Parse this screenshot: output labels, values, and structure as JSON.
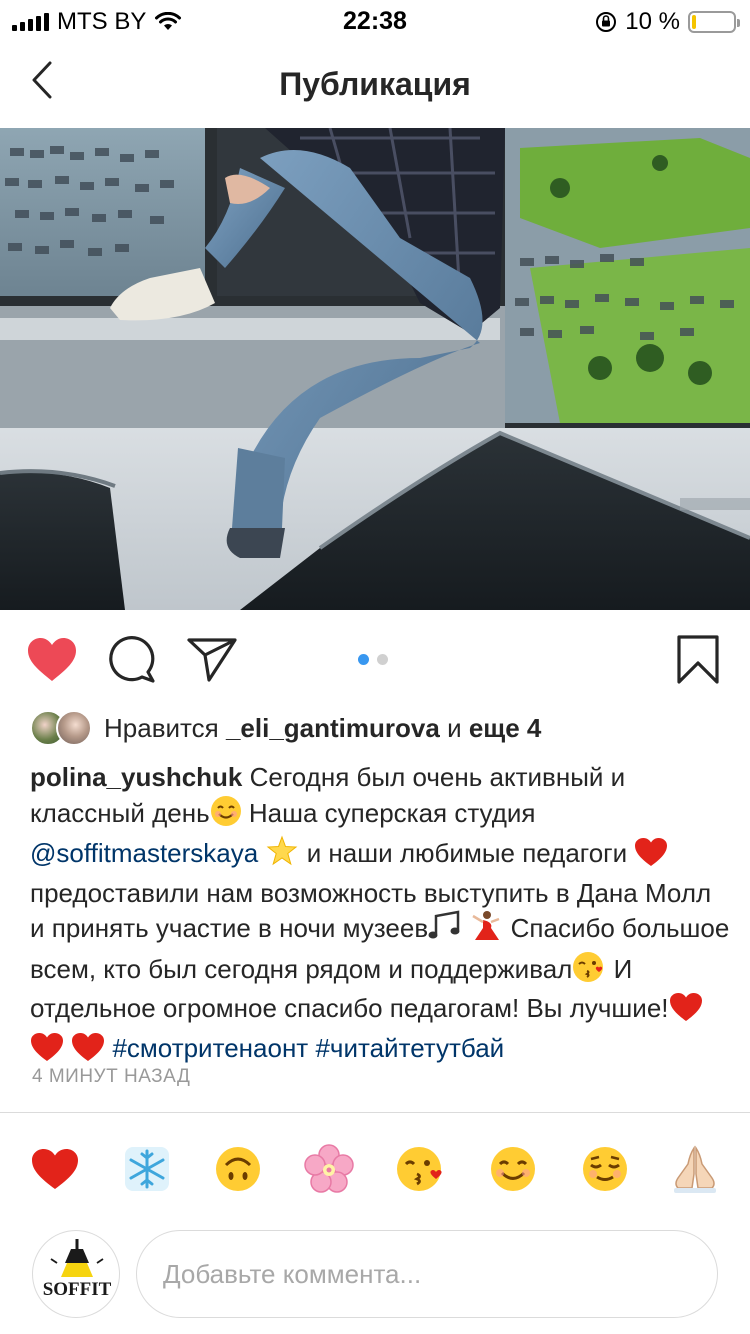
{
  "status_bar": {
    "carrier": "MTS BY",
    "time": "22:38",
    "battery_percent": "10 %",
    "battery_level": 0.1
  },
  "nav": {
    "title": "Публикация",
    "back_icon": "chevron-left-icon"
  },
  "post": {
    "image_alt": "photo",
    "carousel": {
      "total": 2,
      "current": 1
    },
    "actions": {
      "like_icon": "heart-filled-icon",
      "comment_icon": "comment-bubble-icon",
      "share_icon": "paper-plane-icon",
      "save_icon": "bookmark-icon"
    },
    "likes": {
      "prefix": "Нравится",
      "user": "_eli_gantimurova",
      "connector": "и",
      "others": "еще 4"
    },
    "caption": {
      "username": "polina_yushchuk",
      "seg1": "Сегодня был очень активный и классный день",
      "seg2": "Наша суперская студия",
      "mention": "@soffitmasterskaya",
      "seg3": "и наши любимые педагоги",
      "seg4": "предоставили нам возможность выступить в Дана Молл и принять участие в ночи музеев",
      "seg5": "Спасибо большое всем, кто был сегодня рядом и поддерживал",
      "seg6": "И отдельное огромное спасибо педагогам! Вы лучшие!",
      "hashtag1": "#смотритенаонт",
      "hashtag2": "#читайтетутбай"
    },
    "timestamp": "4 МИНУТ НАЗАД"
  },
  "quick_reactions": [
    {
      "name": "red-heart-emoji",
      "glyph": "❤️"
    },
    {
      "name": "snowflake-emoji",
      "glyph": "❄️"
    },
    {
      "name": "upside-down-face-emoji",
      "glyph": "🙃"
    },
    {
      "name": "cherry-blossom-emoji",
      "glyph": "🌸"
    },
    {
      "name": "face-blowing-kiss-emoji",
      "glyph": "😘"
    },
    {
      "name": "smiling-face-emoji",
      "glyph": "😊"
    },
    {
      "name": "relieved-face-emoji",
      "glyph": "😌"
    },
    {
      "name": "folded-hands-emoji",
      "glyph": "🙏"
    }
  ],
  "comment": {
    "avatar_logo": "SOFFIT",
    "placeholder": "Добавьте коммента..."
  },
  "colors": {
    "like_red": "#ed4956",
    "link_blue": "#003569",
    "dot_active": "#3897f0",
    "muted": "#999999"
  }
}
